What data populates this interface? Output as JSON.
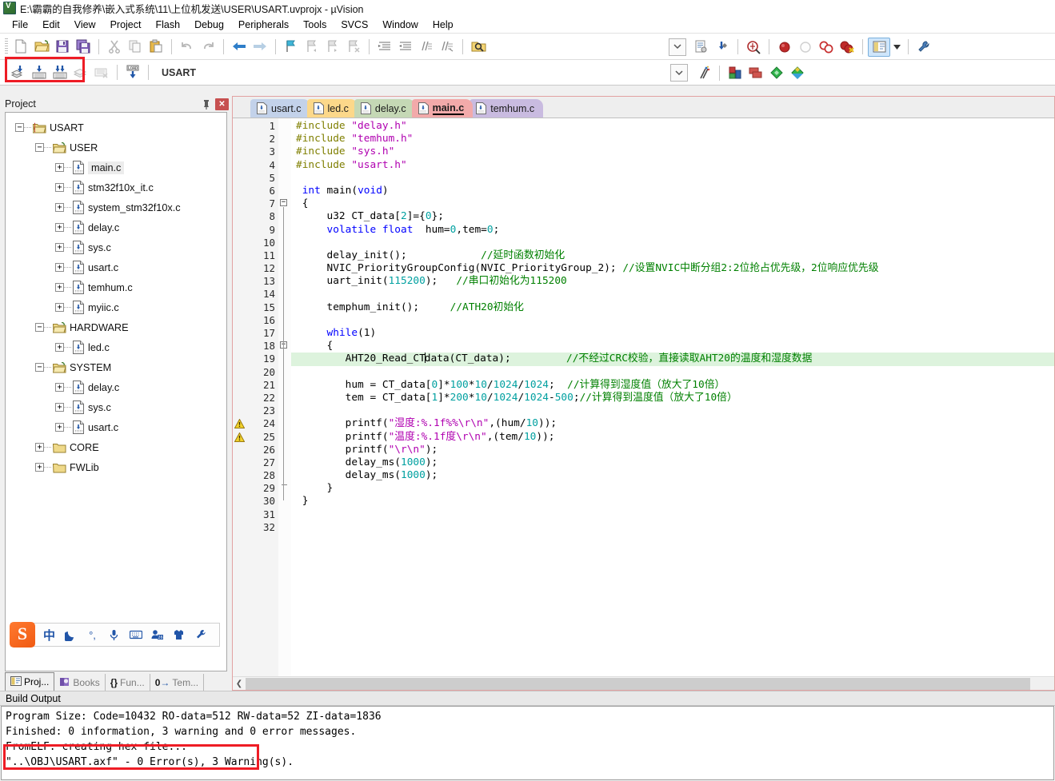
{
  "window": {
    "title": "E:\\霸霸的自我修养\\嵌入式系统\\11\\上位机发送\\USER\\USART.uvprojx - µVision",
    "app_icon": "uvision-logo-icon"
  },
  "menu": {
    "items": [
      "File",
      "Edit",
      "View",
      "Project",
      "Flash",
      "Debug",
      "Peripherals",
      "Tools",
      "SVCS",
      "Window",
      "Help"
    ]
  },
  "toolbar_main": {
    "groups": [
      [
        "new-file-icon",
        "open-file-icon",
        "save-icon",
        "save-all-icon"
      ],
      [
        "cut-icon",
        "copy-icon",
        "paste-icon"
      ],
      [
        "undo-icon",
        "redo-icon"
      ],
      [
        "navigate-back-icon",
        "navigate-forward-icon"
      ],
      [
        "bookmark-toggle-icon",
        "bookmark-prev-icon",
        "bookmark-next-icon",
        "bookmark-clear-icon"
      ],
      [
        "indent-increase-icon",
        "indent-decrease-icon",
        "comment-lines-icon",
        "uncomment-lines-icon"
      ],
      [
        "find-in-files-icon"
      ]
    ],
    "right_groups": [
      [
        "combo-dropdown-icon",
        "configure-target-icon",
        "manage-components-icon"
      ],
      [
        "debug-session-icon"
      ],
      [
        "breakpoint-insert-icon",
        "breakpoint-disable-icon",
        "breakpoint-disable-all-icon",
        "breakpoint-kill-all-icon"
      ],
      [
        "window-layout-icon",
        "window-layout-dropdown-icon"
      ],
      [
        "configure-toolbar-icon"
      ]
    ]
  },
  "toolbar_build": {
    "buttons": [
      "translate-file-icon",
      "build-target-icon",
      "rebuild-all-icon",
      "batch-build-icon",
      "stop-build-icon",
      "download-to-flash-icon"
    ],
    "target_value": "USART",
    "right_buttons": [
      "target-options-icon",
      "manage-project-items-icon",
      "multi-project-icon",
      "packs-installer-icon",
      "pack-manager-icon"
    ]
  },
  "annotations": {
    "highlight_build_buttons": "red-rectangle-around-build-buttons",
    "highlight_fromelf_line": "red-rectangle-around-fromelf-line"
  },
  "project_panel": {
    "caption": "Project",
    "pin_icon": "pin-icon",
    "close_icon": "close-icon",
    "tree": [
      {
        "label": "USART",
        "depth": 0,
        "type": "project",
        "expander": "minus",
        "selected": false
      },
      {
        "label": "USER",
        "depth": 1,
        "type": "group",
        "expander": "minus",
        "selected": false
      },
      {
        "label": "main.c",
        "depth": 2,
        "type": "file",
        "expander": "plus",
        "selected": true
      },
      {
        "label": "stm32f10x_it.c",
        "depth": 2,
        "type": "file",
        "expander": "plus",
        "selected": false
      },
      {
        "label": "system_stm32f10x.c",
        "depth": 2,
        "type": "file",
        "expander": "plus",
        "selected": false
      },
      {
        "label": "delay.c",
        "depth": 2,
        "type": "file",
        "expander": "plus",
        "selected": false
      },
      {
        "label": "sys.c",
        "depth": 2,
        "type": "file",
        "expander": "plus",
        "selected": false
      },
      {
        "label": "usart.c",
        "depth": 2,
        "type": "file",
        "expander": "plus",
        "selected": false
      },
      {
        "label": "temhum.c",
        "depth": 2,
        "type": "file",
        "expander": "plus",
        "selected": false
      },
      {
        "label": "myiic.c",
        "depth": 2,
        "type": "file",
        "expander": "plus",
        "selected": false
      },
      {
        "label": "HARDWARE",
        "depth": 1,
        "type": "group",
        "expander": "minus",
        "selected": false
      },
      {
        "label": "led.c",
        "depth": 2,
        "type": "file",
        "expander": "plus",
        "selected": false
      },
      {
        "label": "SYSTEM",
        "depth": 1,
        "type": "group",
        "expander": "minus",
        "selected": false
      },
      {
        "label": "delay.c",
        "depth": 2,
        "type": "file",
        "expander": "plus",
        "selected": false
      },
      {
        "label": "sys.c",
        "depth": 2,
        "type": "file",
        "expander": "plus",
        "selected": false
      },
      {
        "label": "usart.c",
        "depth": 2,
        "type": "file",
        "expander": "plus",
        "selected": false
      },
      {
        "label": "CORE",
        "depth": 1,
        "type": "folder",
        "expander": "plus",
        "selected": false
      },
      {
        "label": "FWLib",
        "depth": 1,
        "type": "folder",
        "expander": "plus",
        "selected": false
      }
    ],
    "bottom_tabs": [
      {
        "label": "Proj...",
        "icon": "project-icon",
        "active": true
      },
      {
        "label": "Books",
        "icon": "books-icon",
        "active": false
      },
      {
        "label": "Fun...",
        "icon": "functions-icon",
        "active": false
      },
      {
        "label": "Tem...",
        "icon": "templates-icon",
        "active": false
      }
    ]
  },
  "sogou_bar": {
    "logo": "S",
    "items": [
      "chinese-mode-icon",
      "moon-icon",
      "punctuation-icon",
      "voice-input-icon",
      "soft-keyboard-icon",
      "user-icon",
      "skin-icon",
      "settings-wrench-icon"
    ]
  },
  "editor": {
    "tabs": [
      {
        "label": "usart.c",
        "color": "#c3d2ea",
        "active": false
      },
      {
        "label": "led.c",
        "color": "#fcd88a",
        "active": false
      },
      {
        "label": "delay.c",
        "color": "#c5d8b5",
        "active": false
      },
      {
        "label": "main.c",
        "color": "#f2aaaa",
        "active": true
      },
      {
        "label": "temhum.c",
        "color": "#c9bbe0",
        "active": false
      }
    ],
    "warning_lines": [
      24,
      25
    ],
    "highlight_line": 19,
    "fold_lines": [
      7,
      18,
      29
    ],
    "lines": [
      {
        "n": 1,
        "tokens": [
          {
            "t": "#include ",
            "c": "k-pre"
          },
          {
            "t": "\"delay.h\"",
            "c": "k-str"
          }
        ]
      },
      {
        "n": 2,
        "tokens": [
          {
            "t": "#include ",
            "c": "k-pre"
          },
          {
            "t": "\"temhum.h\"",
            "c": "k-str"
          }
        ]
      },
      {
        "n": 3,
        "tokens": [
          {
            "t": "#include ",
            "c": "k-pre"
          },
          {
            "t": "\"sys.h\"",
            "c": "k-str"
          }
        ]
      },
      {
        "n": 4,
        "tokens": [
          {
            "t": "#include ",
            "c": "k-pre"
          },
          {
            "t": "\"usart.h\"",
            "c": "k-str"
          }
        ]
      },
      {
        "n": 5,
        "tokens": []
      },
      {
        "n": 6,
        "tokens": [
          {
            "t": " ",
            "c": "k-txt"
          },
          {
            "t": "int",
            "c": "k-kw"
          },
          {
            "t": " main(",
            "c": "k-txt"
          },
          {
            "t": "void",
            "c": "k-kw"
          },
          {
            "t": ")",
            "c": "k-txt"
          }
        ]
      },
      {
        "n": 7,
        "tokens": [
          {
            "t": " {",
            "c": "k-txt"
          }
        ]
      },
      {
        "n": 8,
        "tokens": [
          {
            "t": "     u32 CT_data[",
            "c": "k-txt"
          },
          {
            "t": "2",
            "c": "k-num"
          },
          {
            "t": "]={",
            "c": "k-txt"
          },
          {
            "t": "0",
            "c": "k-num"
          },
          {
            "t": "};",
            "c": "k-txt"
          }
        ]
      },
      {
        "n": 9,
        "tokens": [
          {
            "t": "     ",
            "c": "k-txt"
          },
          {
            "t": "volatile float",
            "c": "k-kw"
          },
          {
            "t": "  hum=",
            "c": "k-txt"
          },
          {
            "t": "0",
            "c": "k-num"
          },
          {
            "t": ",tem=",
            "c": "k-txt"
          },
          {
            "t": "0",
            "c": "k-num"
          },
          {
            "t": ";",
            "c": "k-txt"
          }
        ]
      },
      {
        "n": 10,
        "tokens": []
      },
      {
        "n": 11,
        "tokens": [
          {
            "t": "     delay_init();            ",
            "c": "k-txt"
          },
          {
            "t": "//延时函数初始化",
            "c": "k-cmt"
          }
        ]
      },
      {
        "n": 12,
        "tokens": [
          {
            "t": "     NVIC_PriorityGroupConfig(NVIC_PriorityGroup_2); ",
            "c": "k-txt"
          },
          {
            "t": "//设置NVIC中断分组2:2位抢占优先级，2位响应优先级",
            "c": "k-cmt"
          }
        ]
      },
      {
        "n": 13,
        "tokens": [
          {
            "t": "     uart_init(",
            "c": "k-txt"
          },
          {
            "t": "115200",
            "c": "k-num"
          },
          {
            "t": ");   ",
            "c": "k-txt"
          },
          {
            "t": "//串口初始化为115200",
            "c": "k-cmt"
          }
        ]
      },
      {
        "n": 14,
        "tokens": []
      },
      {
        "n": 15,
        "tokens": [
          {
            "t": "     temphum_init();     ",
            "c": "k-txt"
          },
          {
            "t": "//ATH20初始化",
            "c": "k-cmt"
          }
        ]
      },
      {
        "n": 16,
        "tokens": []
      },
      {
        "n": 17,
        "tokens": [
          {
            "t": "     ",
            "c": "k-txt"
          },
          {
            "t": "while",
            "c": "k-kw"
          },
          {
            "t": "(1)",
            "c": "k-txt"
          }
        ]
      },
      {
        "n": 18,
        "tokens": [
          {
            "t": "     {",
            "c": "k-txt"
          }
        ]
      },
      {
        "n": 19,
        "tokens": [
          {
            "t": "        AHT20_Read_CTdata(CT_data);         ",
            "c": "k-txt"
          },
          {
            "t": "//不经过CRC校验，直接读取AHT20的温度和湿度数据",
            "c": "k-cmt"
          }
        ]
      },
      {
        "n": 20,
        "tokens": []
      },
      {
        "n": 21,
        "tokens": [
          {
            "t": "        hum = CT_data[",
            "c": "k-txt"
          },
          {
            "t": "0",
            "c": "k-num"
          },
          {
            "t": "]*",
            "c": "k-txt"
          },
          {
            "t": "100",
            "c": "k-num"
          },
          {
            "t": "*",
            "c": "k-txt"
          },
          {
            "t": "10",
            "c": "k-num"
          },
          {
            "t": "/",
            "c": "k-txt"
          },
          {
            "t": "1024",
            "c": "k-num"
          },
          {
            "t": "/",
            "c": "k-txt"
          },
          {
            "t": "1024",
            "c": "k-num"
          },
          {
            "t": ";  ",
            "c": "k-txt"
          },
          {
            "t": "//计算得到湿度值（放大了10倍）",
            "c": "k-cmt"
          }
        ]
      },
      {
        "n": 22,
        "tokens": [
          {
            "t": "        tem = CT_data[",
            "c": "k-txt"
          },
          {
            "t": "1",
            "c": "k-num"
          },
          {
            "t": "]*",
            "c": "k-txt"
          },
          {
            "t": "200",
            "c": "k-num"
          },
          {
            "t": "*",
            "c": "k-txt"
          },
          {
            "t": "10",
            "c": "k-num"
          },
          {
            "t": "/",
            "c": "k-txt"
          },
          {
            "t": "1024",
            "c": "k-num"
          },
          {
            "t": "/",
            "c": "k-txt"
          },
          {
            "t": "1024",
            "c": "k-num"
          },
          {
            "t": "-",
            "c": "k-txt"
          },
          {
            "t": "500",
            "c": "k-num"
          },
          {
            "t": ";",
            "c": "k-txt"
          },
          {
            "t": "//计算得到温度值（放大了10倍）",
            "c": "k-cmt"
          }
        ]
      },
      {
        "n": 23,
        "tokens": []
      },
      {
        "n": 24,
        "tokens": [
          {
            "t": "        printf(",
            "c": "k-txt"
          },
          {
            "t": "\"湿度:%.1f%%\\r\\n\"",
            "c": "k-str"
          },
          {
            "t": ",(hum/",
            "c": "k-txt"
          },
          {
            "t": "10",
            "c": "k-num"
          },
          {
            "t": "));",
            "c": "k-txt"
          }
        ]
      },
      {
        "n": 25,
        "tokens": [
          {
            "t": "        printf(",
            "c": "k-txt"
          },
          {
            "t": "\"温度:%.1f度\\r\\n\"",
            "c": "k-str"
          },
          {
            "t": ",(tem/",
            "c": "k-txt"
          },
          {
            "t": "10",
            "c": "k-num"
          },
          {
            "t": "));",
            "c": "k-txt"
          }
        ]
      },
      {
        "n": 26,
        "tokens": [
          {
            "t": "        printf(",
            "c": "k-txt"
          },
          {
            "t": "\"\\r\\n\"",
            "c": "k-str"
          },
          {
            "t": ");",
            "c": "k-txt"
          }
        ]
      },
      {
        "n": 27,
        "tokens": [
          {
            "t": "        delay_ms(",
            "c": "k-txt"
          },
          {
            "t": "1000",
            "c": "k-num"
          },
          {
            "t": ");",
            "c": "k-txt"
          }
        ]
      },
      {
        "n": 28,
        "tokens": [
          {
            "t": "        delay_ms(",
            "c": "k-txt"
          },
          {
            "t": "1000",
            "c": "k-num"
          },
          {
            "t": ");",
            "c": "k-txt"
          }
        ]
      },
      {
        "n": 29,
        "tokens": [
          {
            "t": "     }",
            "c": "k-txt"
          }
        ]
      },
      {
        "n": 30,
        "tokens": [
          {
            "t": " }",
            "c": "k-txt"
          }
        ]
      },
      {
        "n": 31,
        "tokens": []
      },
      {
        "n": 32,
        "tokens": []
      }
    ],
    "hscroll_left_arrow": "chevron-left-icon"
  },
  "build_output": {
    "caption": "Build Output",
    "lines": [
      {
        "text": "Program Size: Code=10432 RO-data=512 RW-data=52 ZI-data=1836",
        "clipped": false
      },
      {
        "text": "Finished: 0 information, 3 warning and 0 error messages.",
        "clipped": true
      },
      {
        "text": "FromELF: creating hex file...",
        "clipped": false
      },
      {
        "text": "\"..\\OBJ\\USART.axf\" - 0 Error(s), 3 Warning(s).",
        "clipped": true
      }
    ]
  }
}
